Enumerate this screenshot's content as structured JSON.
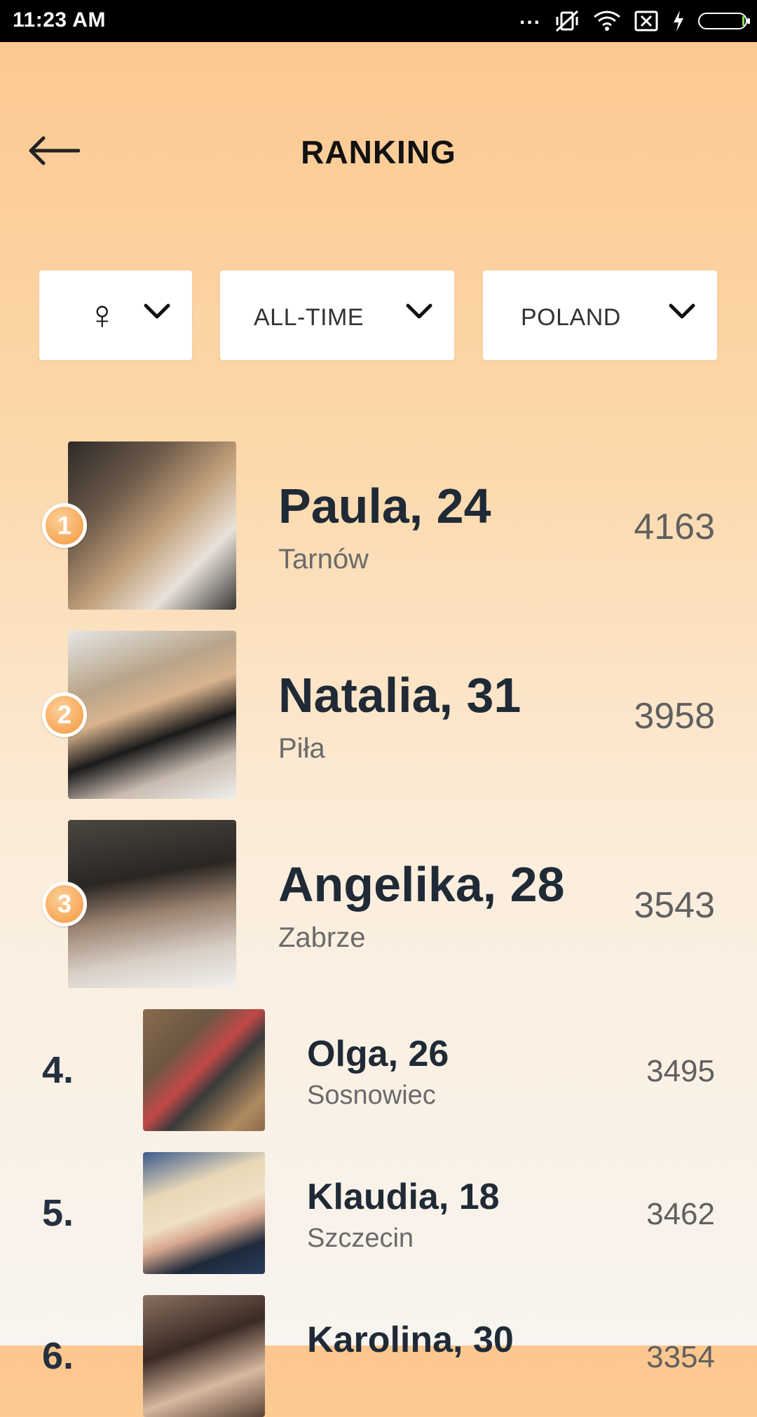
{
  "status_bar": {
    "time": "11:23 AM",
    "dots": "..."
  },
  "header": {
    "title": "RANKING"
  },
  "filters": {
    "gender_symbol": "♀",
    "time_label": "ALL-TIME",
    "country_label": "POLAND"
  },
  "colors": {
    "accent_orange": "#f7a858",
    "text_dark": "#1f2a36"
  },
  "top_ranking": [
    {
      "rank": "1",
      "name": "Paula, 24",
      "city": "Tarnów",
      "score": "4163"
    },
    {
      "rank": "2",
      "name": "Natalia, 31",
      "city": "Piła",
      "score": "3958"
    },
    {
      "rank": "3",
      "name": "Angelika, 28",
      "city": "Zabrze",
      "score": "3543"
    }
  ],
  "list_ranking": [
    {
      "rank": "4.",
      "name": "Olga, 26",
      "city": "Sosnowiec",
      "score": "3495"
    },
    {
      "rank": "5.",
      "name": "Klaudia, 18",
      "city": "Szczecin",
      "score": "3462"
    },
    {
      "rank": "6.",
      "name": "Karolina, 30",
      "city": "",
      "score": "3354"
    }
  ]
}
